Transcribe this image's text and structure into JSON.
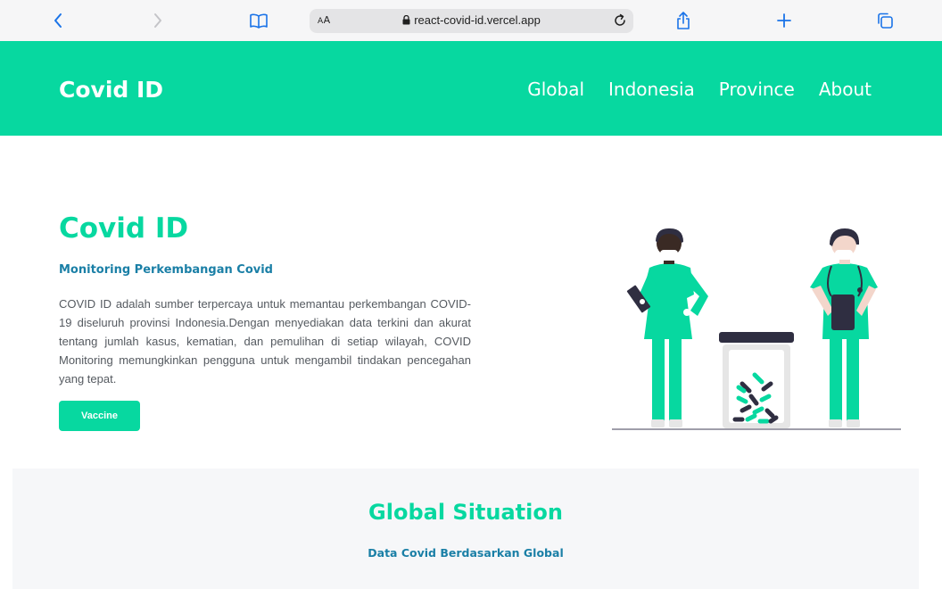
{
  "browser": {
    "text_size_label": "AA",
    "url": "react-covid-id.vercel.app",
    "icons": [
      "back-icon",
      "forward-icon",
      "bookmarks-icon",
      "lock-icon",
      "reload-icon",
      "share-icon",
      "new-tab-icon",
      "tabs-icon"
    ]
  },
  "navbar": {
    "brand": "Covid ID",
    "links": [
      "Global",
      "Indonesia",
      "Province",
      "About"
    ]
  },
  "hero": {
    "title": "Covid ID",
    "subtitle": "Monitoring Perkembangan Covid",
    "description": "COVID ID adalah sumber terpercaya untuk memantau perkembangan COVID-19 diseluruh provinsi Indonesia.Dengan menyediakan data terkini dan akurat tentang jumlah kasus, kematian, dan pemulihan di setiap wilayah, COVID Monitoring memungkinkan pengguna untuk mengambil tindakan pencegahan yang tepat.",
    "button": "Vaccine",
    "illustration": "health-workers-with-pill-jar-illustration"
  },
  "global": {
    "title": "Global Situation",
    "subtitle": "Data Covid Berdasarkan Global"
  },
  "colors": {
    "accent": "#07d8a0",
    "subtitle_blue": "#1a7fa6",
    "browser_bg": "#f6f6f7",
    "section_bg": "#f6f7f9",
    "icon_blue": "#1a73e8"
  }
}
